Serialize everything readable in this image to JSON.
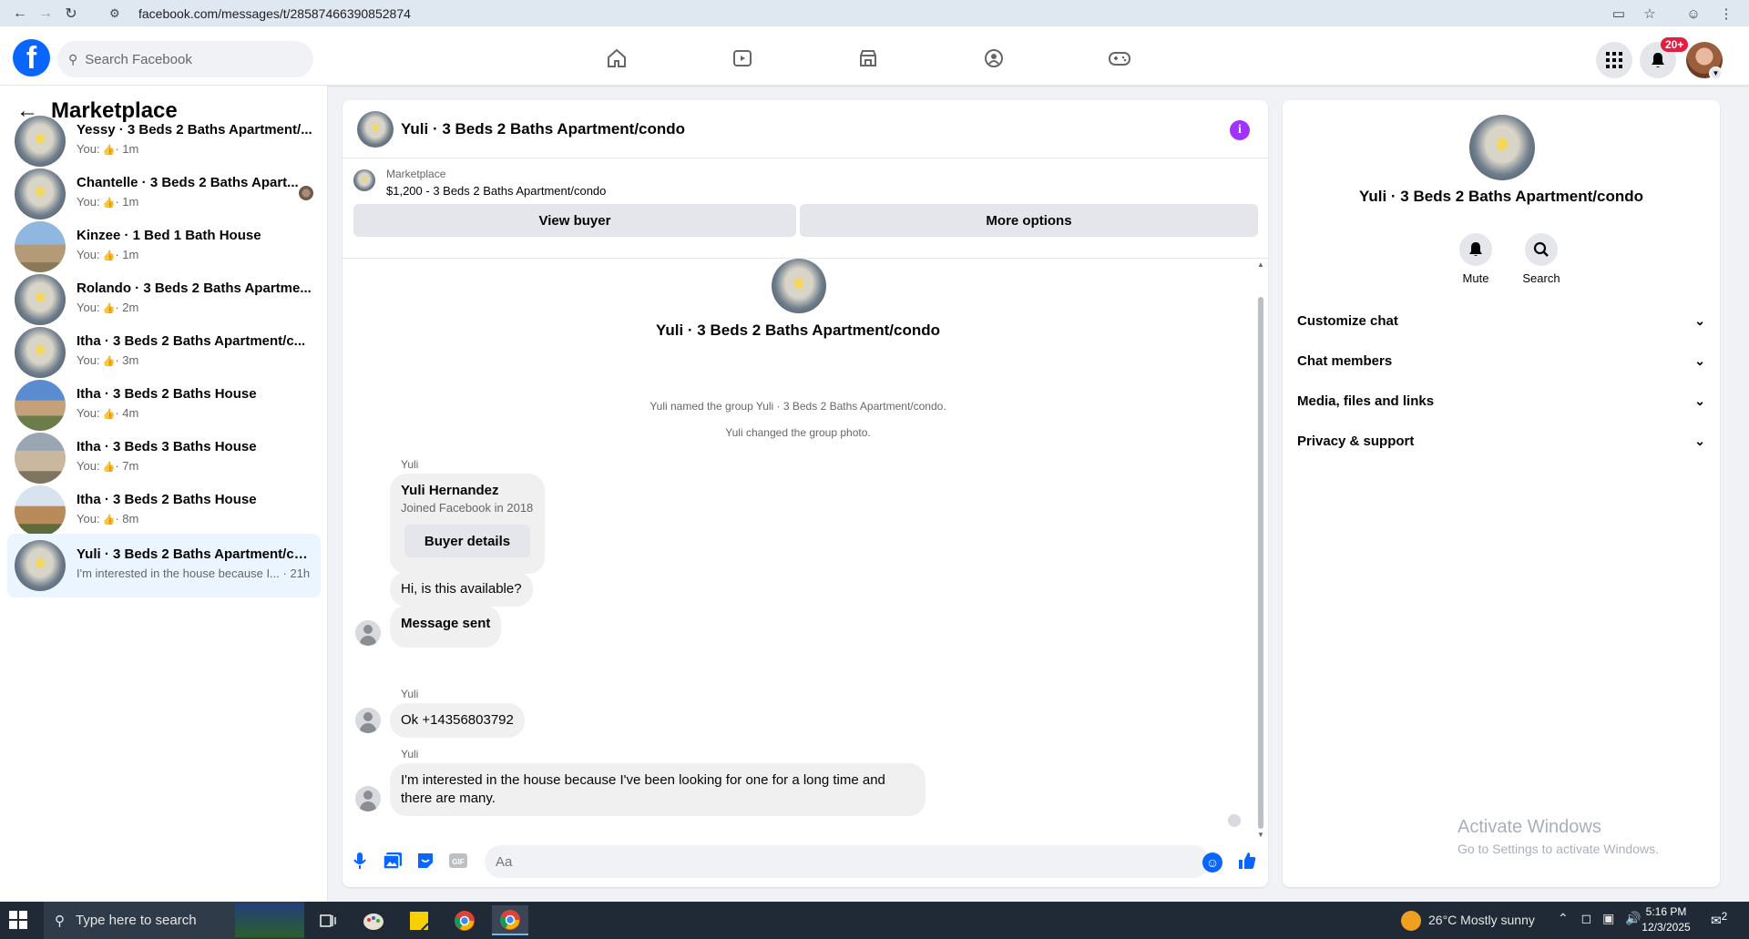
{
  "browser": {
    "url": "facebook.com/messages/t/28587466390852874"
  },
  "fb": {
    "search_placeholder": "Search Facebook",
    "notif_count": "20+"
  },
  "left": {
    "title": "Marketplace",
    "conversations": [
      {
        "name": "Yessy · 3 Beds 2 Baths Apartment/...",
        "sub_prefix": "You:",
        "time": "· 1m",
        "photo": "room"
      },
      {
        "name": "Chantelle · 3 Beds 2 Baths Apart...",
        "sub_prefix": "You:",
        "time": "· 1m",
        "photo": "room"
      },
      {
        "name": "Kinzee · 1 Bed 1 Bath House",
        "sub_prefix": "You:",
        "time": "· 1m",
        "photo": "house1"
      },
      {
        "name": "Rolando · 3 Beds 2 Baths Apartme...",
        "sub_prefix": "You:",
        "time": "· 2m",
        "photo": "room"
      },
      {
        "name": "Itha · 3 Beds 2 Baths Apartment/c...",
        "sub_prefix": "You:",
        "time": "· 3m",
        "photo": "room"
      },
      {
        "name": "Itha · 3 Beds 2 Baths House",
        "sub_prefix": "You:",
        "time": "· 4m",
        "photo": "house2"
      },
      {
        "name": "Itha · 3 Beds 3 Baths House",
        "sub_prefix": "You:",
        "time": "· 7m",
        "photo": "house3"
      },
      {
        "name": "Itha · 3 Beds 2 Baths House",
        "sub_prefix": "You:",
        "time": "· 8m",
        "photo": "house4"
      },
      {
        "name": "Yuli · 3 Beds 2 Baths Apartment/co...",
        "sub": "I'm interested in the house because I... · 21h",
        "photo": "room",
        "active": true
      }
    ]
  },
  "chat": {
    "title": "Yuli · 3 Beds 2 Baths Apartment/condo",
    "marketplace_label": "Marketplace",
    "listing": "$1,200 - 3 Beds 2 Baths Apartment/condo",
    "view_buyer": "View buyer",
    "more_options": "More options",
    "group_name": "Yuli · 3 Beds 2 Baths Apartment/condo",
    "sys1": "Yuli named the group Yuli · 3 Beds 2 Baths Apartment/condo.",
    "sys2": "Yuli changed the group photo.",
    "sender": "Yuli",
    "buyer_name": "Yuli Hernandez",
    "buyer_joined": "Joined Facebook in 2018",
    "buyer_details": "Buyer details",
    "msg1": "Hi, is this available?",
    "msg2": "Message sent",
    "msg3": "Ok +14356803792",
    "msg4_line1": "I'm interested in the house because I've been looking for one for a long time and",
    "msg4_line2": "there are many.",
    "input_placeholder": "Aa"
  },
  "right": {
    "name": "Yuli · 3 Beds 2 Baths Apartment/condo",
    "mute": "Mute",
    "search": "Search",
    "sections": [
      "Customize chat",
      "Chat members",
      "Media, files and links",
      "Privacy & support"
    ],
    "watermark1": "Activate Windows",
    "watermark2": "Go to Settings to activate Windows."
  },
  "taskbar": {
    "search_placeholder": "Type here to search",
    "weather": "26°C  Mostly sunny",
    "time": "5:16 PM",
    "date": "12/3/2025",
    "notif_count": "2"
  },
  "colors": {
    "fb_blue": "#0866ff",
    "info_purple": "#a033ff",
    "active_conv": "#ebf5ff"
  }
}
